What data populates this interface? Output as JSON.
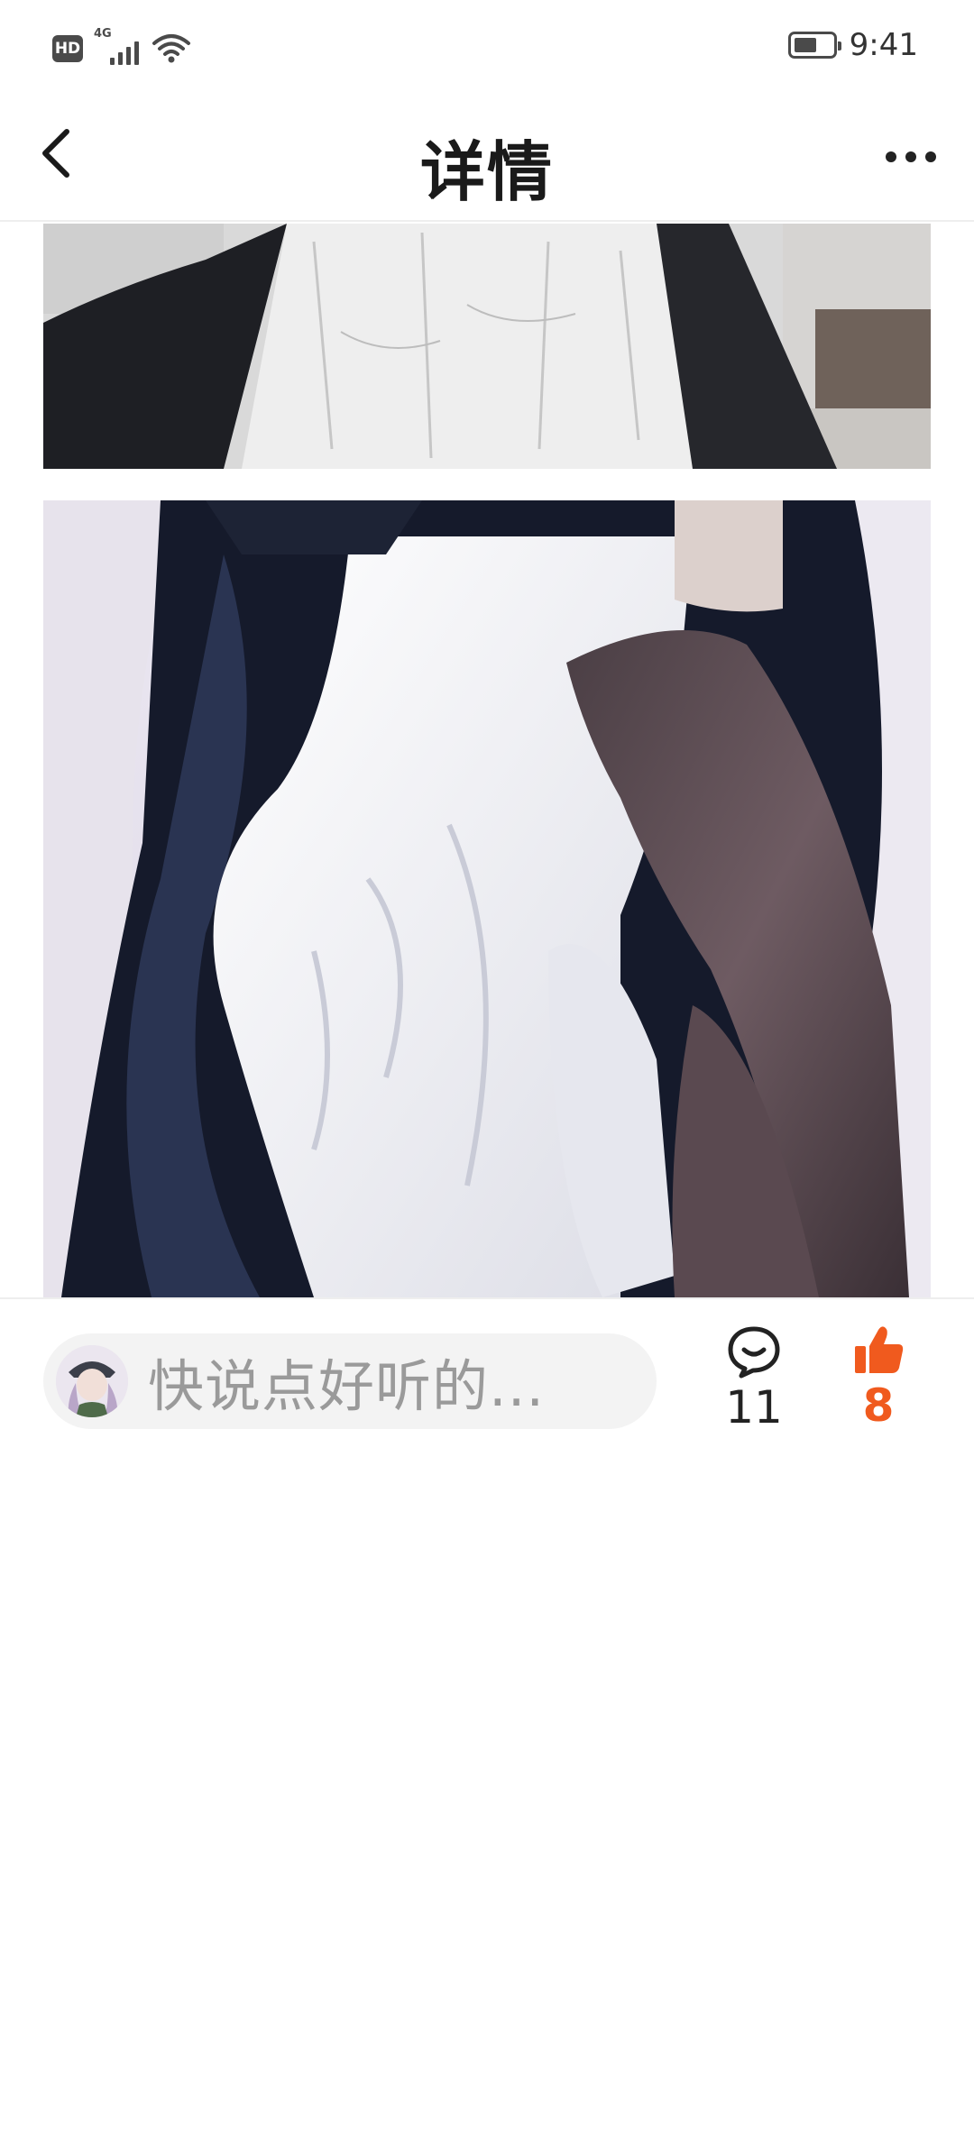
{
  "status_bar": {
    "hd_badge": "HD",
    "network": "4G",
    "time": "9:41",
    "battery_level": 0.6
  },
  "header": {
    "title": "详情",
    "back_icon": "chevron-left-icon",
    "more_icon": "more-horizontal-icon"
  },
  "content": {
    "images": [
      {
        "name": "post-image-1",
        "kind": "photo"
      },
      {
        "name": "post-image-2",
        "kind": "photo"
      }
    ]
  },
  "action_bar": {
    "comment_placeholder": "快说点好听的...",
    "comment_count": "11",
    "like_count": "8",
    "comment_icon": "comment-bubble-icon",
    "like_icon": "thumbs-up-icon",
    "accent_color": "#f05a1e"
  }
}
